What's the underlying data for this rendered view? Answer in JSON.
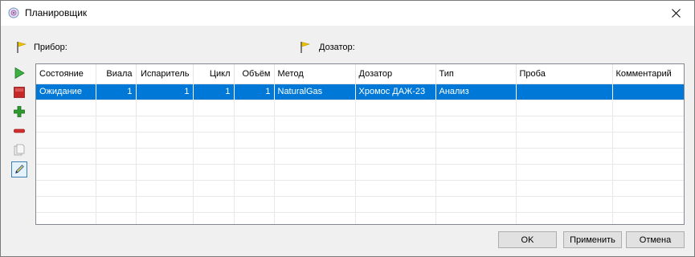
{
  "window": {
    "title": "Планировщик",
    "icon": "app-icon",
    "close_icon": "close-icon"
  },
  "header": {
    "device_label": "Прибор:",
    "dispenser_label": "Дозатор:",
    "flag_color": "#e8c400"
  },
  "toolbar": {
    "items": [
      {
        "icon": "play-icon",
        "color": "#3cb043"
      },
      {
        "icon": "stop-icon",
        "color": "#c62828"
      },
      {
        "icon": "add-icon",
        "color": "#2e9b2e"
      },
      {
        "icon": "remove-icon",
        "color": "#d32f2f"
      },
      {
        "icon": "copy-icon",
        "color": "#b0b0b0"
      },
      {
        "icon": "edit-icon",
        "color": "#1f5fa8"
      }
    ]
  },
  "table": {
    "columns": [
      "Состояние",
      "Виала",
      "Испаритель",
      "Цикл",
      "Объём",
      "Метод",
      "Дозатор",
      "Тип",
      "Проба",
      "Комментарий"
    ],
    "rows": [
      [
        "Ожидание",
        "1",
        "1",
        "1",
        "1",
        "NaturalGas",
        "Хромос ДАЖ-23",
        "Анализ",
        "",
        ""
      ]
    ],
    "selected_color": "#0078d7"
  },
  "buttons": {
    "ok": "OK",
    "apply": "Применить",
    "cancel": "Отмена"
  }
}
